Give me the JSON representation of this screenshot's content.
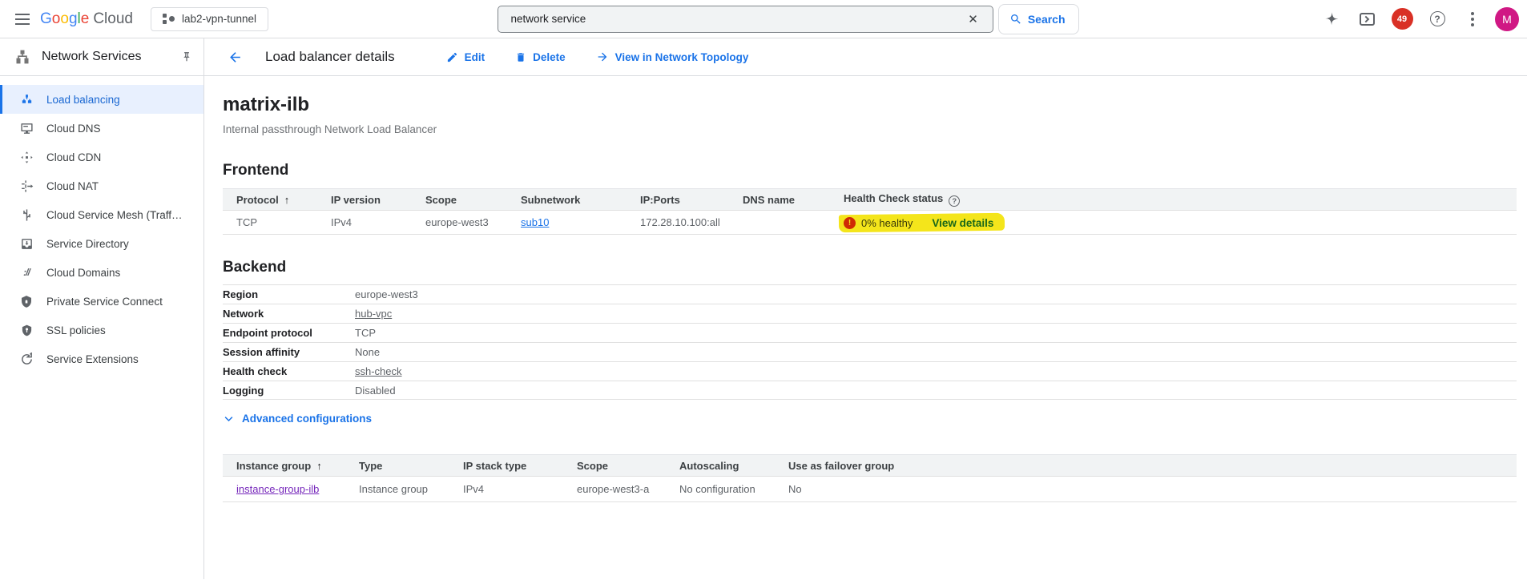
{
  "colors": {
    "accent_blue": "#1a73e8",
    "selected_nav_blue": "#1967d2",
    "visited_link_purple": "#7627bb",
    "error_red": "#d93025",
    "notification_red": "#d93025",
    "avatar_pink": "#d01884",
    "highlight_yellow": "#f4e51b",
    "table_header_gray": "#f1f3f4"
  },
  "icons": {
    "sort_asc": "↑",
    "help": "?",
    "error": "!",
    "clear": "✕",
    "domains_glyph": "://"
  },
  "topbar": {
    "logo_google_letters": [
      "G",
      "o",
      "o",
      "g",
      "l",
      "e"
    ],
    "logo_cloud": "Cloud",
    "project_selector": "lab2-vpn-tunnel",
    "search_value": "network service",
    "search_button_label": "Search",
    "notification_count": "49",
    "avatar_initial": "M"
  },
  "sidebar": {
    "title": "Network Services",
    "items": [
      {
        "label": "Load balancing",
        "selected": true
      },
      {
        "label": "Cloud DNS"
      },
      {
        "label": "Cloud CDN"
      },
      {
        "label": "Cloud NAT"
      },
      {
        "label": "Cloud Service Mesh (Traff…"
      },
      {
        "label": "Service Directory"
      },
      {
        "label": "Cloud Domains"
      },
      {
        "label": "Private Service Connect"
      },
      {
        "label": "SSL policies"
      },
      {
        "label": "Service Extensions"
      }
    ]
  },
  "actionbar": {
    "title": "Load balancer details",
    "edit_label": "Edit",
    "delete_label": "Delete",
    "topology_label": "View in Network Topology"
  },
  "main": {
    "title": "matrix-ilb",
    "subtitle": "Internal passthrough Network Load Balancer",
    "frontend": {
      "heading": "Frontend",
      "columns": [
        "Protocol",
        "IP version",
        "Scope",
        "Subnetwork",
        "IP:Ports",
        "DNS name",
        "Health Check status"
      ],
      "row": {
        "protocol": "TCP",
        "ip_version": "IPv4",
        "scope": "europe-west3",
        "subnetwork": "sub10",
        "ip_ports": "172.28.10.100:all",
        "dns_name": "",
        "health_status": "0% healthy",
        "health_details_link": "View details"
      }
    },
    "backend": {
      "heading": "Backend",
      "rows": [
        {
          "label": "Region",
          "value": "europe-west3"
        },
        {
          "label": "Network",
          "value": "hub-vpc"
        },
        {
          "label": "Endpoint protocol",
          "value": "TCP"
        },
        {
          "label": "Session affinity",
          "value": "None"
        },
        {
          "label": "Health check",
          "value": "ssh-check"
        },
        {
          "label": "Logging",
          "value": "Disabled"
        }
      ],
      "advanced_label": "Advanced configurations"
    },
    "instance_table": {
      "columns": [
        "Instance group",
        "Type",
        "IP stack type",
        "Scope",
        "Autoscaling",
        "Use as failover group"
      ],
      "row": {
        "instance_group": "instance-group-ilb",
        "type": "Instance group",
        "ip_stack_type": "IPv4",
        "scope": "europe-west3-a",
        "autoscaling": "No configuration",
        "failover": "No"
      }
    }
  }
}
